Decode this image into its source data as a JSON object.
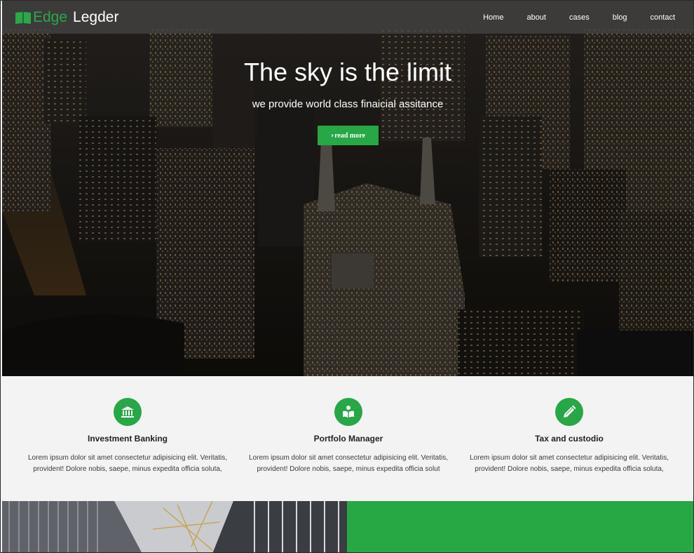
{
  "brand": {
    "name_part1": "Edge",
    "name_part2": "Legder",
    "icon": "book-icon",
    "accent_color": "#27a745"
  },
  "nav": {
    "items": [
      {
        "label": "Home"
      },
      {
        "label": "about"
      },
      {
        "label": "cases"
      },
      {
        "label": "blog"
      },
      {
        "label": "contact"
      }
    ]
  },
  "hero": {
    "title": "The sky is the limit",
    "subtitle": "we provide world class finaicial assitance",
    "cta_label": "read more",
    "cta_icon": "chevron-right-icon",
    "background": "aerial-city-night-photo"
  },
  "services": [
    {
      "icon": "bank-icon",
      "title": "Investment Banking",
      "line1": "Lorem ipsum dolor sit amet consectetur adipisicing elit. Veritatis,",
      "line2": "provident! Dolore nobis, saepe, minus expedita officia soluta,"
    },
    {
      "icon": "reader-icon",
      "title": "Portfolo Manager",
      "line1": "Lorem ipsum dolor sit amet consectetur adipisicing elit. Veritatis,",
      "line2": "provident! Dolore nobis, saepe, minus expedita officia solut"
    },
    {
      "icon": "pencil-icon",
      "title": "Tax and custodio",
      "line1": "Lorem ipsum dolor sit amet consectetur adipisicing elit. Veritatis,",
      "line2": "provident! Dolore nobis, saepe, minus expedita officia soluta,"
    }
  ],
  "bottom": {
    "left_image": "office-interior-photo",
    "right_color": "#28a745"
  }
}
